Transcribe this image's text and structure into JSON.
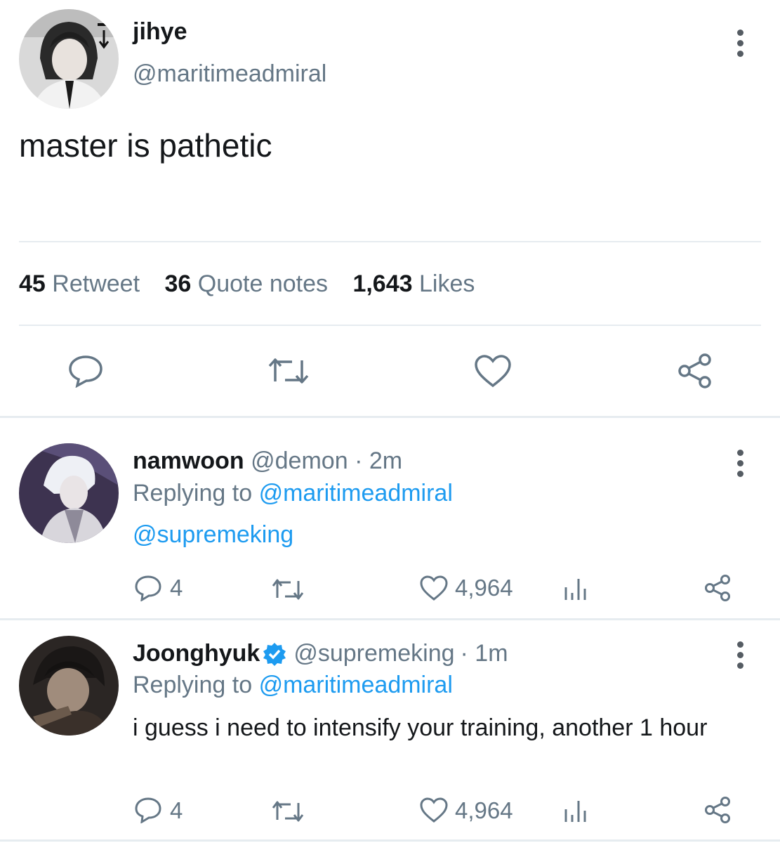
{
  "main_tweet": {
    "display_name": "jihye",
    "handle": "@maritimeadmiral",
    "text": "master is pathetic",
    "stats": {
      "retweets_count": "45",
      "retweets_label": "Retweet",
      "quotes_count": "36",
      "quotes_label": "Quote notes",
      "likes_count": "1,643",
      "likes_label": "Likes"
    }
  },
  "replies": [
    {
      "display_name": "namwoon",
      "handle": "@demon",
      "time": "· 2m",
      "replying_label": "Replying to",
      "replying_to": "@maritimeadmiral",
      "text": "@supremeking",
      "reply_count": "4",
      "like_count": "4,964"
    },
    {
      "display_name": "Joonghyuk",
      "verified": true,
      "handle": "@supremeking",
      "time": "· 1m",
      "replying_label": "Replying to",
      "replying_to": "@maritimeadmiral",
      "text": "i guess i need to intensify your training, another 1 hour",
      "reply_count": "4",
      "like_count": "4,964"
    }
  ],
  "icons": {
    "reply": "reply-icon",
    "retweet": "retweet-icon",
    "like": "heart-icon",
    "share": "share-icon",
    "analytics": "analytics-icon",
    "more": "more-vertical-icon",
    "verified": "verified-badge-icon"
  },
  "colors": {
    "link_blue": "#1d9bf0",
    "secondary_text": "#657786",
    "divider": "#e6ecf0"
  }
}
